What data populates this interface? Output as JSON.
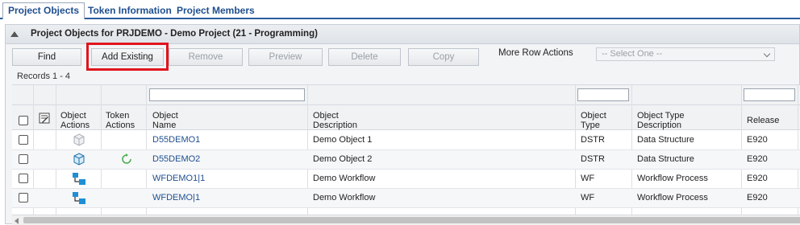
{
  "tabs": [
    {
      "label": "Project Objects",
      "active": true
    },
    {
      "label": "Token Information",
      "active": false
    },
    {
      "label": "Project Members",
      "active": false
    }
  ],
  "panel": {
    "title": "Project Objects for PRJDEMO - Demo Project  (21 - Programming)"
  },
  "toolbar": {
    "find": "Find",
    "add_existing": "Add Existing",
    "remove": "Remove",
    "preview": "Preview",
    "delete": "Delete",
    "copy": "Copy",
    "more_row_actions": "More Row Actions",
    "select_value": "-- Select One --"
  },
  "records": "Records 1 - 4",
  "columns": {
    "object_actions": [
      "Object",
      "Actions"
    ],
    "token_actions": [
      "Token",
      "Actions"
    ],
    "object_name": [
      "Object",
      "Name"
    ],
    "object_description": [
      "Object",
      "Description"
    ],
    "object_type": [
      "Object",
      "Type"
    ],
    "object_type_description": [
      "Object Type",
      "Description"
    ],
    "release": "Release"
  },
  "rows": [
    {
      "name": "D55DEMO1",
      "description": "Demo Object 1",
      "type": "DSTR",
      "type_description": "Data Structure",
      "release": "E920",
      "object_icon": "data-structure-faded-icon",
      "token_icon": ""
    },
    {
      "name": "D55DEMO2",
      "description": "Demo Object 2",
      "type": "DSTR",
      "type_description": "Data Structure",
      "release": "E920",
      "object_icon": "data-structure-icon",
      "token_icon": "refresh-token-icon"
    },
    {
      "name": "WFDEMO1|1",
      "description": "Demo Workflow",
      "type": "WF",
      "type_description": "Workflow Process",
      "release": "E920",
      "object_icon": "workflow-icon",
      "token_icon": ""
    },
    {
      "name": "WFDEMO|1",
      "description": "Demo Workflow",
      "type": "WF",
      "type_description": "Workflow Process",
      "release": "E920",
      "object_icon": "workflow-icon",
      "token_icon": ""
    }
  ],
  "colors": {
    "link": "#1f4f8f",
    "highlight": "#e0141d",
    "workflow_icon": "#1e8fd6",
    "refresh_icon": "#4caf50"
  }
}
